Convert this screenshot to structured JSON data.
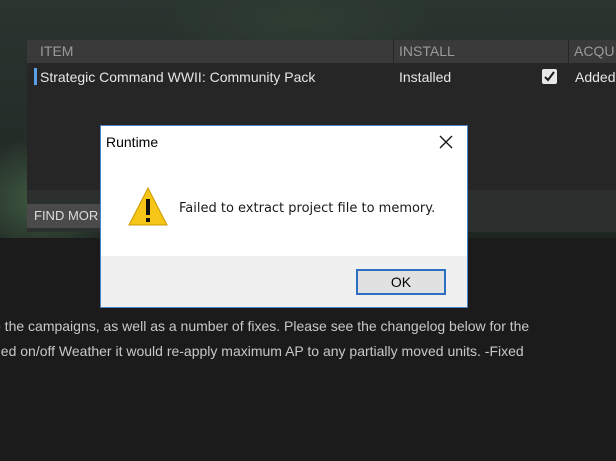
{
  "table": {
    "headers": {
      "item": "ITEM",
      "install": "INSTALL",
      "acquired": "ACQU"
    },
    "rows": [
      {
        "item": "Strategic Command WWII: Community Pack",
        "install": "Installed",
        "checked": true,
        "acquired": "Added"
      }
    ]
  },
  "find_more_button": "FIND MOR",
  "description": {
    "line1": "o the campaigns, as well as a number of fixes. Please see the changelog below for the",
    "line2": "ned on/off Weather it would re-apply maximum AP to any partially moved units. -Fixed"
  },
  "dialog": {
    "title": "Runtime",
    "message": "Failed to extract project file to memory.",
    "ok_label": "OK",
    "icon": "warning-icon"
  },
  "colors": {
    "accent": "#5aa0e8",
    "dialog_border": "#4a82c8",
    "ok_border": "#2f6fbf",
    "warning": "#f5c518"
  }
}
